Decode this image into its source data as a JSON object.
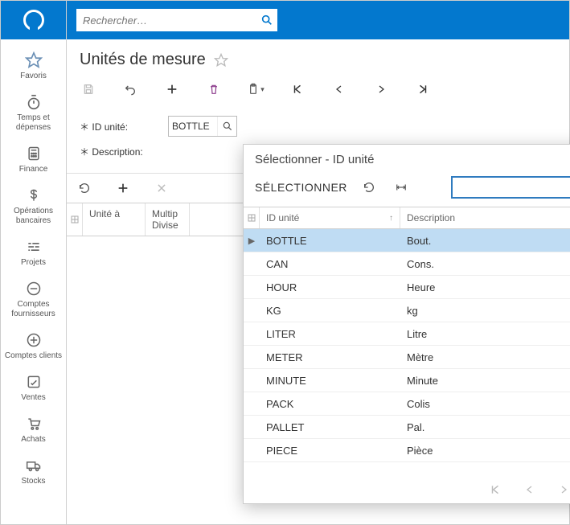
{
  "search": {
    "placeholder": "Rechercher…"
  },
  "page": {
    "title": "Unités de mesure"
  },
  "sidebar": {
    "items": [
      {
        "label": "Favoris"
      },
      {
        "label": "Temps et dépenses"
      },
      {
        "label": "Finance"
      },
      {
        "label": "Opérations bancaires"
      },
      {
        "label": "Projets"
      },
      {
        "label": "Comptes fournisseurs"
      },
      {
        "label": "Comptes clients"
      },
      {
        "label": "Ventes"
      },
      {
        "label": "Achats"
      },
      {
        "label": "Stocks"
      }
    ]
  },
  "form": {
    "id_label": "ID unité:",
    "desc_label": "Description:",
    "id_value": "BOTTLE"
  },
  "grid": {
    "col1": "Unité à",
    "col2a": "Multip",
    "col2b": "Divise"
  },
  "popup": {
    "title": "Sélectionner - ID unité",
    "select_label": "SÉLECTIONNER",
    "col_id": "ID unité",
    "col_desc": "Description",
    "rows": [
      {
        "id": "BOTTLE",
        "desc": "Bout.",
        "selected": true
      },
      {
        "id": "CAN",
        "desc": "Cons."
      },
      {
        "id": "HOUR",
        "desc": "Heure"
      },
      {
        "id": "KG",
        "desc": "kg"
      },
      {
        "id": "LITER",
        "desc": "Litre"
      },
      {
        "id": "METER",
        "desc": "Mètre"
      },
      {
        "id": "MINUTE",
        "desc": "Minute"
      },
      {
        "id": "PACK",
        "desc": "Colis"
      },
      {
        "id": "PALLET",
        "desc": "Pal."
      },
      {
        "id": "PIECE",
        "desc": "Pièce"
      }
    ]
  }
}
